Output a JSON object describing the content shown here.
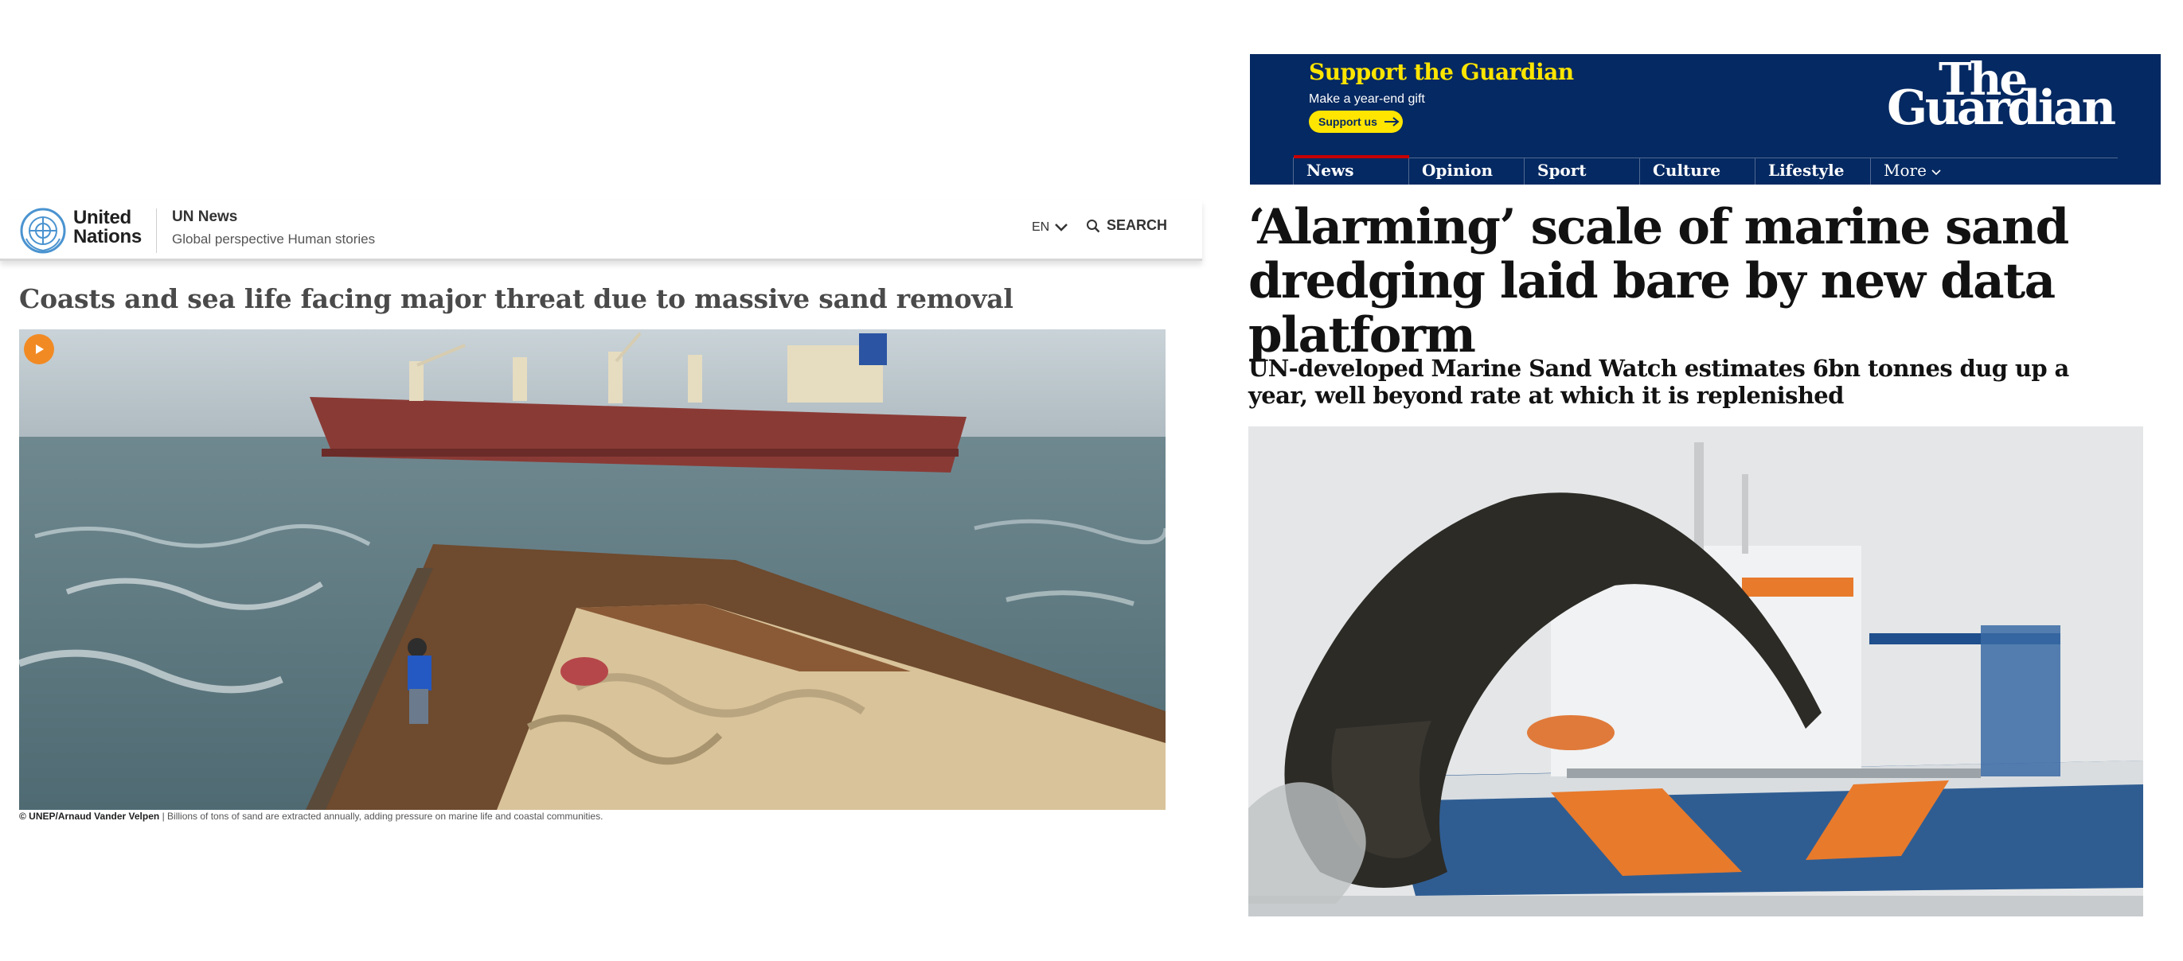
{
  "un_news": {
    "org_name_line1": "United",
    "org_name_line2": "Nations",
    "site_title": "UN News",
    "site_tagline": "Global perspective Human stories",
    "language": "EN",
    "search_label": "SEARCH",
    "headline": "Coasts and sea life facing major threat due to massive sand removal",
    "photo_alt": "Sand barge alongside a cargo ship at sea",
    "caption_credit": "© UNEP/Arnaud Vander Velpen",
    "caption_separator": " | ",
    "caption_text": "Billions of tons of sand are extracted annually, adding pressure on marine life and coastal communities.",
    "accent_color": "#f28a24"
  },
  "guardian": {
    "support_title": "Support the Guardian",
    "support_subtitle": "Make a year-end gift",
    "support_button": "Support us",
    "logo_line1": "The",
    "logo_line2": "Guardian",
    "nav": {
      "items": [
        "News",
        "Opinion",
        "Sport",
        "Culture",
        "Lifestyle"
      ],
      "more_label": "More"
    },
    "headline": "‘Alarming’ scale of marine sand dredging laid bare by new data platform",
    "standfirst": "UN-developed Marine Sand Watch estimates 6bn tonnes dug up a year, well beyond rate at which it is replenished",
    "photo_alt": "Dredging vessel spraying dark sediment",
    "brand_color": "#052962",
    "highlight_color": "#ffe500",
    "active_nav_color": "#c70000"
  }
}
